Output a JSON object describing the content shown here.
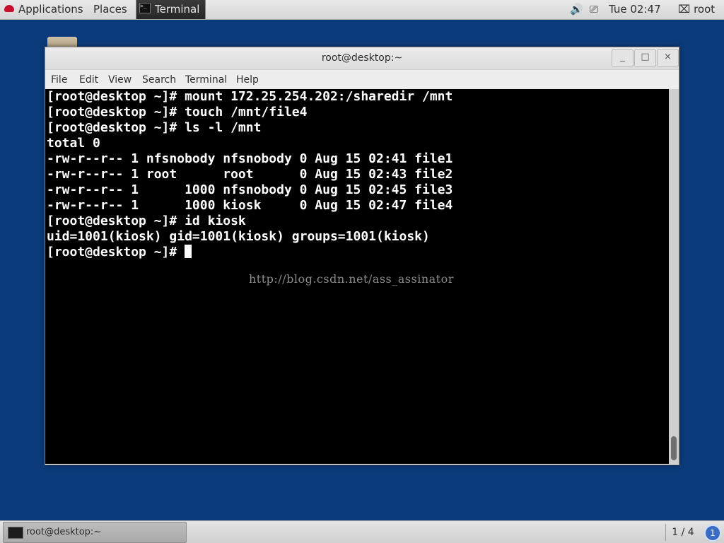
{
  "top_panel": {
    "applications": "Applications",
    "places": "Places",
    "task": "Terminal",
    "clock": "Tue 02:47",
    "user": "root"
  },
  "window": {
    "title": "root@desktop:~",
    "controls": {
      "minimize": "_",
      "maximize": "□",
      "close": "×"
    },
    "menus": [
      "File",
      "Edit",
      "View",
      "Search",
      "Terminal",
      "Help"
    ]
  },
  "terminal": {
    "lines": [
      "[root@desktop ~]# mount 172.25.254.202:/sharedir /mnt",
      "[root@desktop ~]# touch /mnt/file4",
      "[root@desktop ~]# ls -l /mnt",
      "total 0",
      "-rw-r--r-- 1 nfsnobody nfsnobody 0 Aug 15 02:41 file1",
      "-rw-r--r-- 1 root      root      0 Aug 15 02:43 file2",
      "-rw-r--r-- 1      1000 nfsnobody 0 Aug 15 02:45 file3",
      "-rw-r--r-- 1      1000 kiosk     0 Aug 15 02:47 file4",
      "[root@desktop ~]# id kiosk",
      "uid=1001(kiosk) gid=1001(kiosk) groups=1001(kiosk)"
    ],
    "prompt": "[root@desktop ~]# ",
    "watermark": "http://blog.csdn.net/ass_assinator"
  },
  "bottom_panel": {
    "task": "root@desktop:~",
    "workspace": "1 / 4",
    "notification": "1"
  },
  "icons": {
    "apps": "redhat-icon",
    "volume": "🔊",
    "network": "⎚",
    "user": "⌧"
  }
}
